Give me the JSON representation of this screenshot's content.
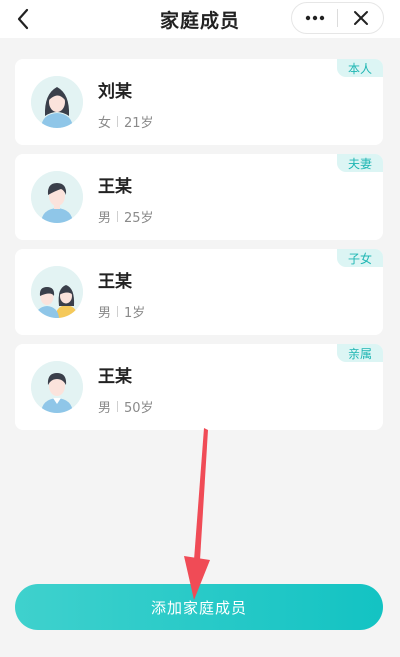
{
  "nav": {
    "title": "家庭成员",
    "back_icon": "chevron-left-icon",
    "more_icon": "more-dots-icon",
    "close_icon": "close-icon"
  },
  "members": [
    {
      "name": "刘某",
      "gender": "女",
      "age": "21岁",
      "relation": "本人",
      "avatar": "female-avatar-icon"
    },
    {
      "name": "王某",
      "gender": "男",
      "age": "25岁",
      "relation": "夫妻",
      "avatar": "male-avatar-icon"
    },
    {
      "name": "王某",
      "gender": "男",
      "age": "1岁",
      "relation": "子女",
      "avatar": "children-avatar-icon"
    },
    {
      "name": "王某",
      "gender": "男",
      "age": "50岁",
      "relation": "亲属",
      "avatar": "male-avatar-icon"
    }
  ],
  "add_button": {
    "label": "添加家庭成员"
  },
  "colors": {
    "accent": "#13c3c3",
    "tag_bg": "#dcf5f4",
    "tag_text": "#1fb6b3",
    "annotation_arrow": "#f04b56"
  }
}
